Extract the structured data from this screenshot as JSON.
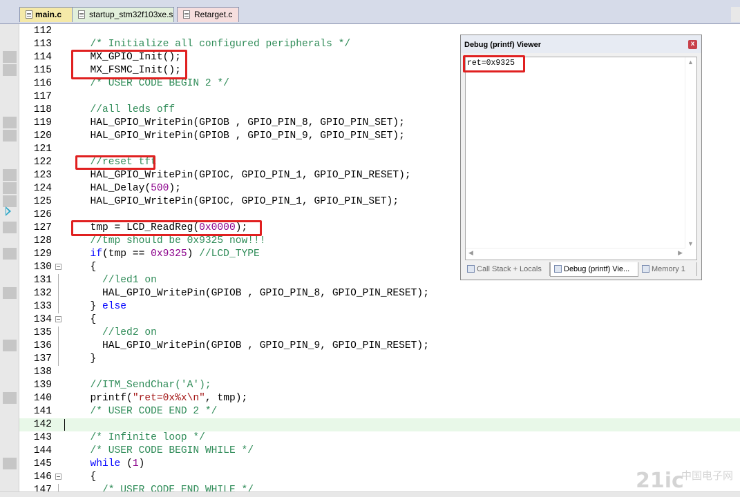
{
  "tabs": [
    {
      "label": "main.c"
    },
    {
      "label": "startup_stm32f103xe.s"
    },
    {
      "label": "Retarget.c"
    }
  ],
  "code_lines": [
    {
      "num": "112",
      "html": ""
    },
    {
      "num": "113",
      "html": "<span class=\"cm\">/* Initialize all configured peripherals */</span>"
    },
    {
      "num": "114",
      "html": "MX_GPIO_Init();"
    },
    {
      "num": "115",
      "html": "MX_FSMC_Init();"
    },
    {
      "num": "116",
      "html": "<span class=\"cm\">/* USER CODE BEGIN 2 */</span>"
    },
    {
      "num": "117",
      "html": ""
    },
    {
      "num": "118",
      "html": "<span class=\"cm\">//all leds off</span>"
    },
    {
      "num": "119",
      "html": "HAL_GPIO_WritePin(GPIOB , GPIO_PIN_8, GPIO_PIN_SET);"
    },
    {
      "num": "120",
      "html": "HAL_GPIO_WritePin(GPIOB , GPIO_PIN_9, GPIO_PIN_SET);"
    },
    {
      "num": "121",
      "html": ""
    },
    {
      "num": "122",
      "html": "<span class=\"cm\">//reset tft</span>"
    },
    {
      "num": "123",
      "html": "HAL_GPIO_WritePin(GPIOC, GPIO_PIN_1, GPIO_PIN_RESET);"
    },
    {
      "num": "124",
      "html": "HAL_Delay(<span class=\"num\">500</span>);"
    },
    {
      "num": "125",
      "html": "HAL_GPIO_WritePin(GPIOC, GPIO_PIN_1, GPIO_PIN_SET);"
    },
    {
      "num": "126",
      "html": ""
    },
    {
      "num": "127",
      "html": "tmp = LCD_ReadReg(<span class=\"num\">0x0000</span>);"
    },
    {
      "num": "128",
      "html": "<span class=\"cm\">//tmp should be 0x9325 now!!!</span>"
    },
    {
      "num": "129",
      "html": "<span class=\"kw\">if</span>(tmp == <span class=\"num\">0x9325</span>) <span class=\"cm\">//LCD_TYPE</span>"
    },
    {
      "num": "130",
      "html": "{"
    },
    {
      "num": "131",
      "html": "  <span class=\"cm\">//led1 on</span>"
    },
    {
      "num": "132",
      "html": "  HAL_GPIO_WritePin(GPIOB , GPIO_PIN_8, GPIO_PIN_RESET);"
    },
    {
      "num": "133",
      "html": "} <span class=\"kw\">else</span>"
    },
    {
      "num": "134",
      "html": "{"
    },
    {
      "num": "135",
      "html": "  <span class=\"cm\">//led2 on</span>"
    },
    {
      "num": "136",
      "html": "  HAL_GPIO_WritePin(GPIOB , GPIO_PIN_9, GPIO_PIN_RESET);"
    },
    {
      "num": "137",
      "html": "}"
    },
    {
      "num": "138",
      "html": ""
    },
    {
      "num": "139",
      "html": "<span class=\"cm\">//ITM_SendChar('A');</span>"
    },
    {
      "num": "140",
      "html": "printf(<span class=\"str\">\"ret=0x%x\\n\"</span>, tmp);"
    },
    {
      "num": "141",
      "html": "<span class=\"cm\">/* USER CODE END 2 */</span>"
    },
    {
      "num": "142",
      "html": ""
    },
    {
      "num": "143",
      "html": "<span class=\"cm\">/* Infinite loop */</span>"
    },
    {
      "num": "144",
      "html": "<span class=\"cm\">/* USER CODE BEGIN WHILE */</span>"
    },
    {
      "num": "145",
      "html": "<span class=\"kw\">while</span> (<span class=\"num\">1</span>)"
    },
    {
      "num": "146",
      "html": "{"
    },
    {
      "num": "147",
      "html": "  <span class=\"cm\">/* USER CODE END WHILE */</span>"
    }
  ],
  "debug_viewer": {
    "title": "Debug (printf) Viewer",
    "close_glyph": "x",
    "output": "ret=0x9325",
    "tabs": [
      {
        "label": "Call Stack + Locals"
      },
      {
        "label": "Debug (printf) Vie..."
      },
      {
        "label": "Memory 1"
      }
    ]
  },
  "watermark": {
    "brand": "21ic",
    "cn": "中国电子网"
  }
}
